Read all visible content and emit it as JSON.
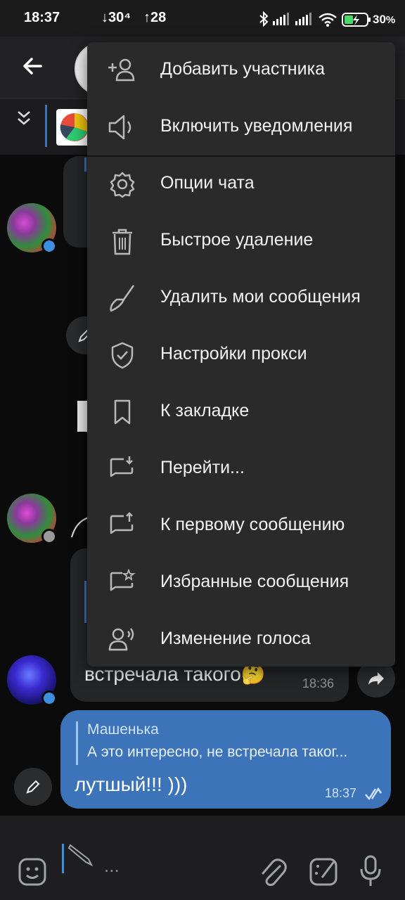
{
  "status_bar": {
    "time": "18:37",
    "download_speed": "↓30⁴",
    "upload_speed": "↑28",
    "battery": "30",
    "battery_unit": "%"
  },
  "chat": {
    "message_in_text_visible": "встречала такого🤔",
    "message_in_time": "18:36",
    "message_out": {
      "reply_author": "Машенька",
      "reply_text": "А это интересно, не встречала таког...",
      "text": "лутшый!!! )))",
      "time": "18:37"
    }
  },
  "composer": {
    "placeholder": "..."
  },
  "menu": {
    "items": [
      {
        "label": "Добавить участника",
        "icon": "add-user-icon"
      },
      {
        "label": "Включить уведомления",
        "icon": "speaker-icon"
      },
      {
        "label": "Опции чата",
        "icon": "gear-icon"
      },
      {
        "label": "Быстрое удаление",
        "icon": "trash-icon"
      },
      {
        "label": "Удалить мои сообщения",
        "icon": "broom-icon"
      },
      {
        "label": "Настройки прокси",
        "icon": "shield-icon"
      },
      {
        "label": "К закладке",
        "icon": "bookmark-icon"
      },
      {
        "label": "Перейти...",
        "icon": "goto-message-icon"
      },
      {
        "label": "К первому сообщению",
        "icon": "first-message-icon"
      },
      {
        "label": "Избранные сообщения",
        "icon": "starred-message-icon"
      },
      {
        "label": "Изменение голоса",
        "icon": "voice-change-icon"
      }
    ]
  },
  "colors": {
    "accent": "#3d73b8",
    "menu_background": "#2a2a2b",
    "online_dot": "#3d8fe0"
  }
}
